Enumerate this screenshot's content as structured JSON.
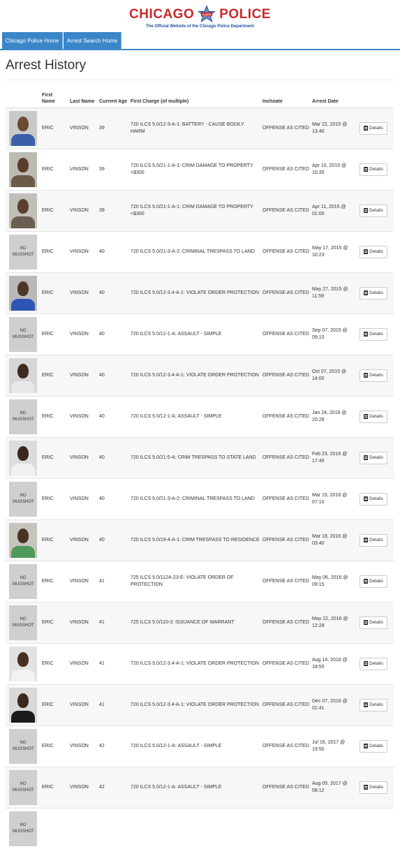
{
  "header": {
    "logo_left": "CHICAGO",
    "logo_right": "POLICE",
    "badge_text": "CAPS",
    "tagline": "The Official Website of the Chicago Police Department",
    "logo_color": "#c8282a",
    "tagline_color": "#1f4f9c"
  },
  "nav": {
    "items": [
      {
        "label": "Chicago Police Home"
      },
      {
        "label": "Arrest Search Home"
      }
    ],
    "color": "#3a86c8"
  },
  "page": {
    "title": "Arrest History"
  },
  "table": {
    "columns": {
      "photo": "",
      "first": "First Name",
      "last": "Last Name",
      "age": "Current Age",
      "charge": "First Charge (of multiple)",
      "inchoate": "Inchoate",
      "date": "Arrest Date"
    },
    "details_label": "Details",
    "no_mugshot_label": "NO MUGSHOT",
    "rows": [
      {
        "first": "ERIC",
        "last": "VINSON",
        "age": "39",
        "charge": "720 ILCS 5.0/12-3-A-1: BATTERY - CAUSE BODILY HARM",
        "inchoate": "OFFENSE AS CITED",
        "date": "Mar 22, 2015 @ 13:40",
        "mugshot": true,
        "skin": "#6b4a34",
        "shirt": "#3b5fa8",
        "bg": "#c9c9c9"
      },
      {
        "first": "ERIC",
        "last": "VINSON",
        "age": "39",
        "charge": "720 ILCS 5.0/21-1-A-1: CRIM DAMAGE TO PROPERTY <$300",
        "inchoate": "OFFENSE AS CITED",
        "date": "Apr 10, 2015 @ 10:35",
        "mugshot": true,
        "skin": "#5a3d2a",
        "shirt": "#6a5a48",
        "bg": "#bdbab4"
      },
      {
        "first": "ERIC",
        "last": "VINSON",
        "age": "39",
        "charge": "720 ILCS 5.0/21-1-A-1: CRIM DAMAGE TO PROPERTY <$300",
        "inchoate": "OFFENSE AS CITED",
        "date": "Apr 11, 2015 @ 01:00",
        "mugshot": true,
        "skin": "#5c402d",
        "shirt": "#6b5f52",
        "bg": "#c2bfba"
      },
      {
        "first": "ERIC",
        "last": "VINSON",
        "age": "40",
        "charge": "720 ILCS 5.0/21-3-A-2: CRIMINAL TRESPASS TO LAND",
        "inchoate": "OFFENSE AS CITED",
        "date": "May 17, 2015 @ 10:23",
        "mugshot": false
      },
      {
        "first": "ERIC",
        "last": "VINSON",
        "age": "40",
        "charge": "720 ILCS 5.0/12-3.4-A-1: VIOLATE ORDER PROTECTION",
        "inchoate": "OFFENSE AS CITED",
        "date": "May 27, 2015 @ 11:59",
        "mugshot": true,
        "skin": "#4f3526",
        "shirt": "#2d55b5",
        "bg": "#b8b8b8"
      },
      {
        "first": "ERIC",
        "last": "VINSON",
        "age": "40",
        "charge": "720 ILCS 5.0/12-1-A: ASSAULT - SIMPLE",
        "inchoate": "OFFENSE AS CITED",
        "date": "Sep 07, 2015 @ 09:10",
        "mugshot": false
      },
      {
        "first": "ERIC",
        "last": "VINSON",
        "age": "40",
        "charge": "720 ILCS 5.0/12-3.4-A-1: VIOLATE ORDER PROTECTION",
        "inchoate": "OFFENSE AS CITED",
        "date": "Oct 07, 2015 @ 14:00",
        "mugshot": true,
        "skin": "#3e2a1f",
        "shirt": "#e8e8e8",
        "bg": "#d6d6d6"
      },
      {
        "first": "ERIC",
        "last": "VINSON",
        "age": "40",
        "charge": "720 ILCS 5.0/12-1-A: ASSAULT - SIMPLE",
        "inchoate": "OFFENSE AS CITED",
        "date": "Jan 24, 2016 @ 20:28",
        "mugshot": false
      },
      {
        "first": "ERIC",
        "last": "VINSON",
        "age": "40",
        "charge": "720 ILCS 5.0/21-5-A: CRIM TRESPASS TO STATE LAND",
        "inchoate": "OFFENSE AS CITED",
        "date": "Feb 23, 2016 @ 17:45",
        "mugshot": true,
        "skin": "#3a281d",
        "shirt": "#f0f0f0",
        "bg": "#dcdcdc"
      },
      {
        "first": "ERIC",
        "last": "VINSON",
        "age": "40",
        "charge": "720 ILCS 5.0/21-3-A-2: CRIMINAL TRESPASS TO LAND",
        "inchoate": "OFFENSE AS CITED",
        "date": "Mar 15, 2016 @ 07:10",
        "mugshot": false
      },
      {
        "first": "ERIC",
        "last": "VINSON",
        "age": "40",
        "charge": "720 ILCS 5.0/19-4-A-1: CRIM TRESPASS TO RESIDENCE",
        "inchoate": "OFFENSE AS CITED",
        "date": "Mar 19, 2016 @ 03:40",
        "mugshot": true,
        "skin": "#4a3224",
        "shirt": "#4f9a5a",
        "bg": "#c7c3bd"
      },
      {
        "first": "ERIC",
        "last": "VINSON",
        "age": "41",
        "charge": "725 ILCS 5.0/112A-23-E: VIOLATE ORDER OF PROTECTION",
        "inchoate": "OFFENSE AS CITED",
        "date": "May 06, 2016 @ 09:15",
        "mugshot": false
      },
      {
        "first": "ERIC",
        "last": "VINSON",
        "age": "41",
        "charge": "725 ILCS 5.0/110-3: ISSUANCE OF WARRANT",
        "inchoate": "OFFENSE AS CITED",
        "date": "May 22, 2016 @ 12:28",
        "mugshot": false
      },
      {
        "first": "ERIC",
        "last": "VINSON",
        "age": "41",
        "charge": "720 ILCS 5.0/12-3.4-A-1: VIOLATE ORDER PROTECTION",
        "inchoate": "OFFENSE AS CITED",
        "date": "Aug 14, 2016 @ 18:55",
        "mugshot": true,
        "skin": "#4a3023",
        "shirt": "#f2f2f2",
        "bg": "#e2e2e2"
      },
      {
        "first": "ERIC",
        "last": "VINSON",
        "age": "41",
        "charge": "720 ILCS 5.0/12-3.4-A-1: VIOLATE ORDER PROTECTION",
        "inchoate": "OFFENSE AS CITED",
        "date": "Dec 07, 2016 @ 01:41",
        "mugshot": true,
        "skin": "#3c281c",
        "shirt": "#1c1c1c",
        "bg": "#d9d9d9"
      },
      {
        "first": "ERIC",
        "last": "VINSON",
        "age": "42",
        "charge": "720 ILCS 5.0/12-1-A: ASSAULT - SIMPLE",
        "inchoate": "OFFENSE AS CITED",
        "date": "Jul 16, 2017 @ 19:50",
        "mugshot": false
      },
      {
        "first": "ERIC",
        "last": "VINSON",
        "age": "42",
        "charge": "720 ILCS 5.0/12-1-A: ASSAULT - SIMPLE",
        "inchoate": "OFFENSE AS CITED",
        "date": "Aug 05, 2017 @ 08:12",
        "mugshot": false
      },
      {
        "first": "",
        "last": "",
        "age": "",
        "charge": "",
        "inchoate": "",
        "date": "",
        "mugshot": false
      }
    ]
  }
}
